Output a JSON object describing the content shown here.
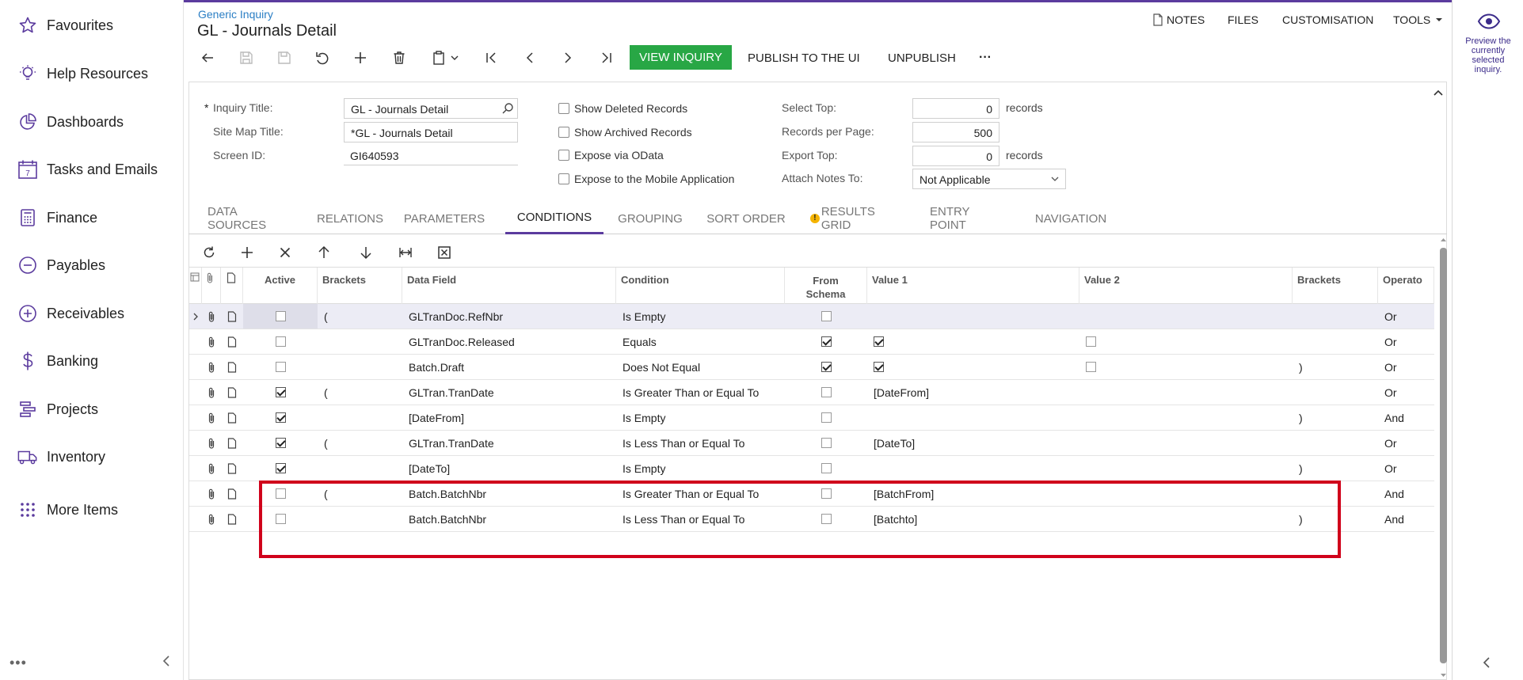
{
  "nav": {
    "items": [
      {
        "label": "Favourites",
        "icon": "star-icon"
      },
      {
        "label": "Help Resources",
        "icon": "lightbulb-icon"
      },
      {
        "label": "Dashboards",
        "icon": "pie-chart-icon"
      },
      {
        "label": "Tasks and Emails",
        "icon": "calendar-icon",
        "badge": "7"
      },
      {
        "label": "Finance",
        "icon": "calculator-icon"
      },
      {
        "label": "Payables",
        "icon": "minus-circle-icon"
      },
      {
        "label": "Receivables",
        "icon": "plus-circle-icon"
      },
      {
        "label": "Banking",
        "icon": "dollar-icon"
      },
      {
        "label": "Projects",
        "icon": "projects-icon"
      },
      {
        "label": "Inventory",
        "icon": "truck-icon"
      },
      {
        "label": "More Items",
        "icon": "grid-dots-icon"
      }
    ]
  },
  "header": {
    "breadcrumb": "Generic Inquiry",
    "title": "GL - Journals Detail",
    "links": {
      "notes": "NOTES",
      "files": "FILES",
      "customisation": "CUSTOMISATION",
      "tools": "TOOLS"
    }
  },
  "toolbar": {
    "view_inquiry": "VIEW INQUIRY",
    "publish": "PUBLISH TO THE UI",
    "unpublish": "UNPUBLISH",
    "more": "···"
  },
  "rightpanel": {
    "preview_text": "Preview the currently selected inquiry."
  },
  "form": {
    "inquiry_title_label": "Inquiry Title:",
    "inquiry_title_value": "GL - Journals Detail",
    "site_map_title_label": "Site Map Title:",
    "site_map_title_value": "*GL - Journals Detail",
    "screen_id_label": "Screen ID:",
    "screen_id_value": "GI640593",
    "show_deleted": "Show Deleted Records",
    "show_archived": "Show Archived Records",
    "expose_odata": "Expose via OData",
    "expose_mobile": "Expose to the Mobile Application",
    "select_top_label": "Select Top:",
    "select_top_value": "0",
    "records_per_page_label": "Records per Page:",
    "records_per_page_value": "500",
    "export_top_label": "Export Top:",
    "export_top_value": "0",
    "attach_notes_label": "Attach Notes To:",
    "attach_notes_value": "Not Applicable",
    "records_unit": "records",
    "required_mark": "*"
  },
  "tabs": [
    {
      "label": "DATA SOURCES",
      "active": false
    },
    {
      "label": "RELATIONS",
      "active": false
    },
    {
      "label": "PARAMETERS",
      "active": false
    },
    {
      "label": "CONDITIONS",
      "active": true
    },
    {
      "label": "GROUPING",
      "active": false
    },
    {
      "label": "SORT ORDER",
      "active": false
    },
    {
      "label": "RESULTS GRID",
      "active": false,
      "warning": true
    },
    {
      "label": "ENTRY POINT",
      "active": false
    },
    {
      "label": "NAVIGATION",
      "active": false
    }
  ],
  "grid": {
    "headers": {
      "active": "Active",
      "brackets": "Brackets",
      "data_field": "Data Field",
      "condition": "Condition",
      "from_schema_1": "From",
      "from_schema_2": "Schema",
      "value1": "Value 1",
      "value2": "Value 2",
      "brackets2": "Brackets",
      "operator": "Operato"
    },
    "rows": [
      {
        "active": false,
        "open_bracket": "(",
        "data_field": "GLTranDoc.RefNbr",
        "condition": "Is Empty",
        "from_schema": false,
        "value1": "",
        "value1_check": null,
        "value2_check": null,
        "close_bracket": "",
        "operator": "Or",
        "selected": true
      },
      {
        "active": false,
        "open_bracket": "",
        "data_field": "GLTranDoc.Released",
        "condition": "Equals",
        "from_schema": true,
        "value1": "",
        "value1_check": true,
        "value2_check": false,
        "close_bracket": "",
        "operator": "Or"
      },
      {
        "active": false,
        "open_bracket": "",
        "data_field": "Batch.Draft",
        "condition": "Does Not Equal",
        "from_schema": true,
        "value1": "",
        "value1_check": true,
        "value2_check": false,
        "close_bracket": ")",
        "operator": "Or"
      },
      {
        "active": true,
        "open_bracket": "(",
        "data_field": "GLTran.TranDate",
        "condition": "Is Greater Than or Equal To",
        "from_schema": false,
        "value1": "[DateFrom]",
        "value1_check": null,
        "value2_check": null,
        "close_bracket": "",
        "operator": "Or"
      },
      {
        "active": true,
        "open_bracket": "",
        "data_field": "[DateFrom]",
        "condition": "Is Empty",
        "from_schema": false,
        "value1": "",
        "value1_check": null,
        "value2_check": null,
        "close_bracket": ")",
        "operator": "And"
      },
      {
        "active": true,
        "open_bracket": "(",
        "data_field": "GLTran.TranDate",
        "condition": "Is Less Than or Equal To",
        "from_schema": false,
        "value1": "[DateTo]",
        "value1_check": null,
        "value2_check": null,
        "close_bracket": "",
        "operator": "Or"
      },
      {
        "active": true,
        "open_bracket": "",
        "data_field": "[DateTo]",
        "condition": "Is Empty",
        "from_schema": false,
        "value1": "",
        "value1_check": null,
        "value2_check": null,
        "close_bracket": ")",
        "operator": "Or"
      },
      {
        "active": false,
        "open_bracket": "(",
        "data_field": "Batch.BatchNbr",
        "condition": "Is Greater Than or Equal To",
        "from_schema": false,
        "value1": "[BatchFrom]",
        "value1_check": null,
        "value2_check": null,
        "close_bracket": "",
        "operator": "And"
      },
      {
        "active": false,
        "open_bracket": "",
        "data_field": "Batch.BatchNbr",
        "condition": "Is Less Than or Equal To",
        "from_schema": false,
        "value1": "[Batchto]",
        "value1_check": null,
        "value2_check": null,
        "close_bracket": ")",
        "operator": "And"
      }
    ]
  },
  "colors": {
    "accent": "#5b3b9e",
    "view_button": "#28a745",
    "link": "#2a7ec4",
    "highlight": "#d0021b"
  }
}
